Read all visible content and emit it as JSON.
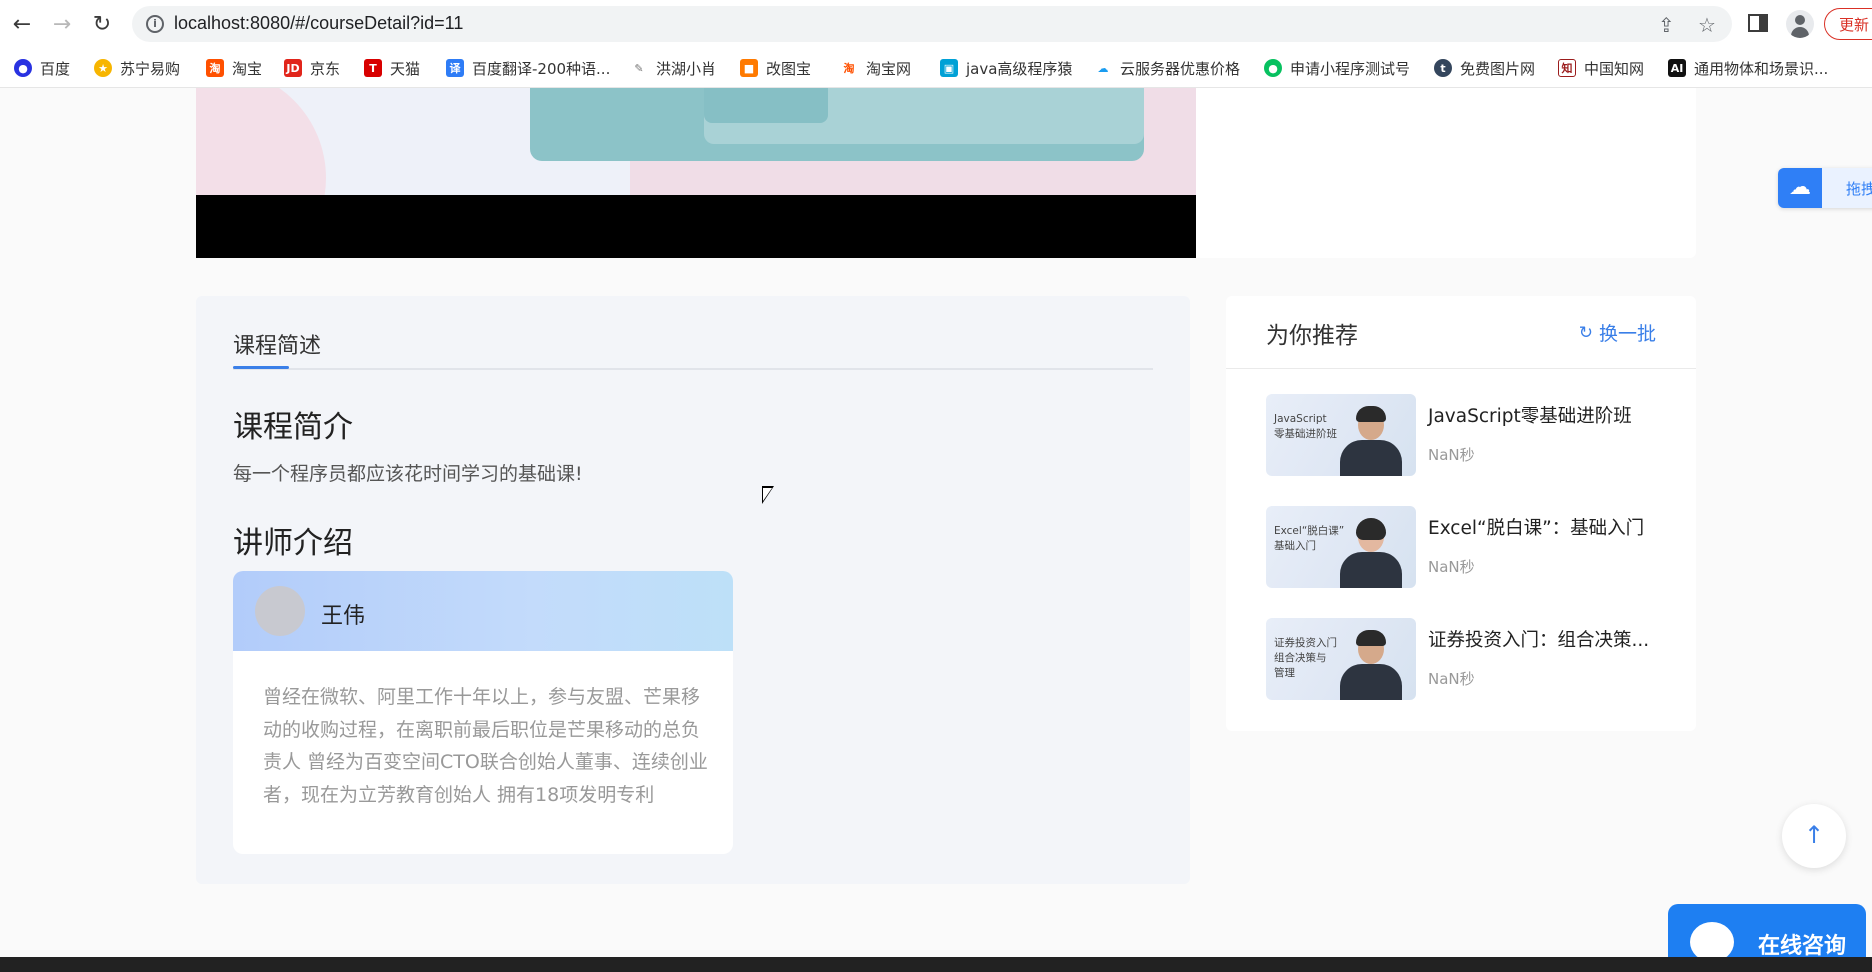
{
  "browser": {
    "url": "localhost:8080/#/courseDetail?id=11",
    "update_label": "更新"
  },
  "bookmarks": [
    {
      "label": "百度",
      "icon": "baidu-icon",
      "color": "#2932e1"
    },
    {
      "label": "苏宁易购",
      "icon": "suning-icon",
      "color": "#f7b500"
    },
    {
      "label": "淘宝",
      "icon": "taobao-icon",
      "color": "#ff5000"
    },
    {
      "label": "京东",
      "icon": "jd-icon",
      "color": "#e1251b"
    },
    {
      "label": "天猫",
      "icon": "tmall-icon",
      "color": "#d80000"
    },
    {
      "label": "百度翻译-200种语...",
      "icon": "baidu-translate-icon",
      "color": "#2e7cf6"
    },
    {
      "label": "洪湖小肖",
      "icon": "feather-icon",
      "color": "#888888"
    },
    {
      "label": "改图宝",
      "icon": "gaitubao-icon",
      "color": "#ff7a00"
    },
    {
      "label": "淘宝网",
      "icon": "taobao-icon",
      "color": "#ff5000"
    },
    {
      "label": "java高级程序猿",
      "icon": "bilibili-icon",
      "color": "#00a1d6"
    },
    {
      "label": "云服务器优惠价格",
      "icon": "cloud-icon",
      "color": "#1a9cf0"
    },
    {
      "label": "申请小程序测试号",
      "icon": "wechat-icon",
      "color": "#07c160"
    },
    {
      "label": "免费图片网",
      "icon": "tumblr-icon",
      "color": "#34465d"
    },
    {
      "label": "中国知网",
      "icon": "cnki-icon",
      "color": "#9b1c1c"
    },
    {
      "label": "通用物体和场景识...",
      "icon": "ai-icon",
      "color": "#111111"
    }
  ],
  "course": {
    "tab_label": "课程简述",
    "intro_heading": "课程简介",
    "intro_text": "每一个程序员都应该花时间学习的基础课!",
    "teacher_heading": "讲师介绍",
    "teacher": {
      "name": "王伟",
      "bio": "曾经在微软、阿里工作十年以上，参与友盟、芒果移动的收购过程，在离职前最后职位是芒果移动的总负责人 曾经为百变空间CTO联合创始人董事、连续创业者，现在为立芳教育创始人 拥有18项发明专利"
    }
  },
  "recommend": {
    "title": "为你推荐",
    "refresh_label": "换一批",
    "items": [
      {
        "title": "JavaScript零基础进阶班",
        "duration": "NaN秒",
        "thumb_text": "JavaScript\n零基础进阶班"
      },
      {
        "title": "Excel“脱白课”：基础入门",
        "duration": "NaN秒",
        "thumb_text": "Excel“脱白课”\n基础入门"
      },
      {
        "title": "证券投资入门：组合决策...",
        "duration": "NaN秒",
        "thumb_text": "证券投资入门\n组合决策与\n管理"
      }
    ]
  },
  "floating": {
    "cloud_label": "拖拽",
    "consult_label": "在线咨询"
  },
  "colors": {
    "accent": "#3a7fe8",
    "consult_bg": "#1e7ff2"
  }
}
